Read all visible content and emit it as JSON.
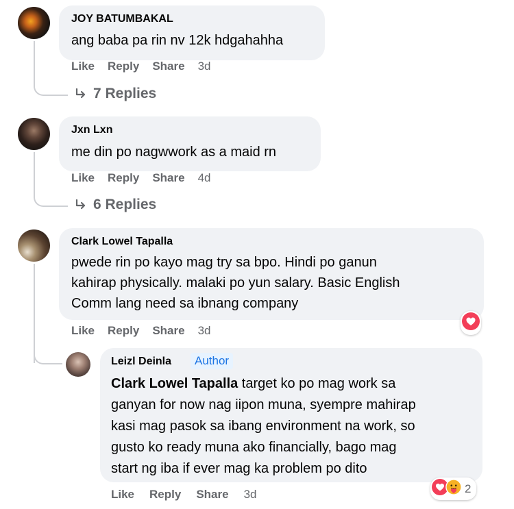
{
  "comments": [
    {
      "author": "JOY BATUMBAKAL",
      "lines": [
        "ang baba pa rin nv 12k hdgahahha"
      ],
      "actions": {
        "like": "Like",
        "reply": "Reply",
        "share": "Share",
        "time": "3d"
      },
      "replies_label": "7 Replies"
    },
    {
      "author": "Jxn Lxn",
      "lines": [
        "me din po nagwwork as a maid rn"
      ],
      "actions": {
        "like": "Like",
        "reply": "Reply",
        "share": "Share",
        "time": "4d"
      },
      "replies_label": "6 Replies"
    },
    {
      "author": "Clark Lowel Tapalla",
      "lines": [
        "pwede rin po kayo mag try sa bpo. Hindi po ganun",
        "kahirap physically. malaki po yun salary. Basic English",
        "Comm lang need sa ibnang company"
      ],
      "actions": {
        "like": "Like",
        "reply": "Reply",
        "share": "Share",
        "time": "3d"
      },
      "reaction": "heart-icon"
    }
  ],
  "reply": {
    "author": "Leizl Deinla",
    "badge": "Author",
    "mention": "Clark Lowel Tapalla",
    "first_line_rest": " target ko po mag work sa",
    "lines": [
      "ganyan for now nag iipon muna, syempre mahirap",
      "kasi mag pasok sa ibang environment na work, so",
      "gusto ko ready muna ako financially, bago mag",
      "start ng iba if ever mag ka problem po dito"
    ],
    "actions": {
      "like": "Like",
      "reply": "Reply",
      "share": "Share",
      "time": "3d"
    },
    "reactions": [
      "heart-icon",
      "care-icon"
    ],
    "reaction_count": "2"
  },
  "colors": {
    "bubble": "#f0f2f5",
    "meta_text": "#65676b",
    "author_badge_bg": "#e7f3ff",
    "author_badge_text": "#1b74e4",
    "heart": "#f33e58",
    "care": "#f7b125"
  }
}
